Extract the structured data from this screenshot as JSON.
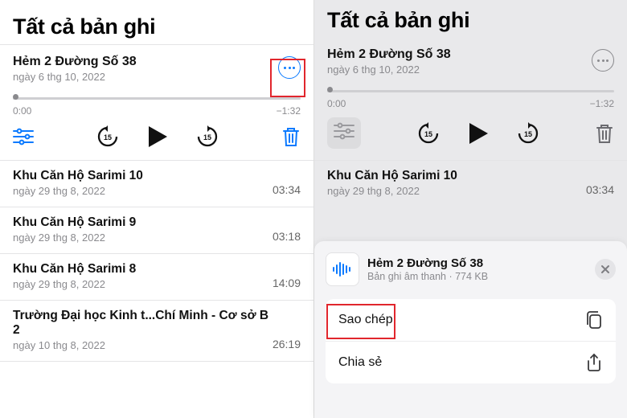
{
  "left": {
    "title": "Tất cả bản ghi",
    "current": {
      "name": "Hẻm 2 Đường Số 38",
      "date": "ngày 6 thg 10, 2022",
      "t_start": "0:00",
      "t_end": "−1:32"
    },
    "items": [
      {
        "name": "Khu Căn Hộ Sarimi 10",
        "date": "ngày 29 thg 8, 2022",
        "dur": "03:34"
      },
      {
        "name": "Khu Căn Hộ Sarimi 9",
        "date": "ngày 29 thg 8, 2022",
        "dur": "03:18"
      },
      {
        "name": "Khu Căn Hộ Sarimi 8",
        "date": "ngày 29 thg 8, 2022",
        "dur": "14:09"
      },
      {
        "name": "Trường Đại học Kinh t...Chí Minh - Cơ sở B 2",
        "date": "ngày 10 thg 8, 2022",
        "dur": "26:19"
      }
    ]
  },
  "right": {
    "title": "Tất cả bản ghi",
    "current": {
      "name": "Hẻm 2 Đường Số 38",
      "date": "ngày 6 thg 10, 2022",
      "t_start": "0:00",
      "t_end": "−1:32"
    },
    "secondary": {
      "name": "Khu Căn Hộ Sarimi 10",
      "date": "ngày 29 thg 8, 2022",
      "dur": "03:34"
    },
    "sheet": {
      "title": "Hẻm 2 Đường Số 38",
      "sub": "Bản ghi âm thanh · 774 KB",
      "actions": {
        "copy": "Sao chép",
        "share": "Chia sẻ"
      }
    }
  },
  "colors": {
    "accent": "#0a7aff",
    "highlight_border": "#e1262d"
  }
}
